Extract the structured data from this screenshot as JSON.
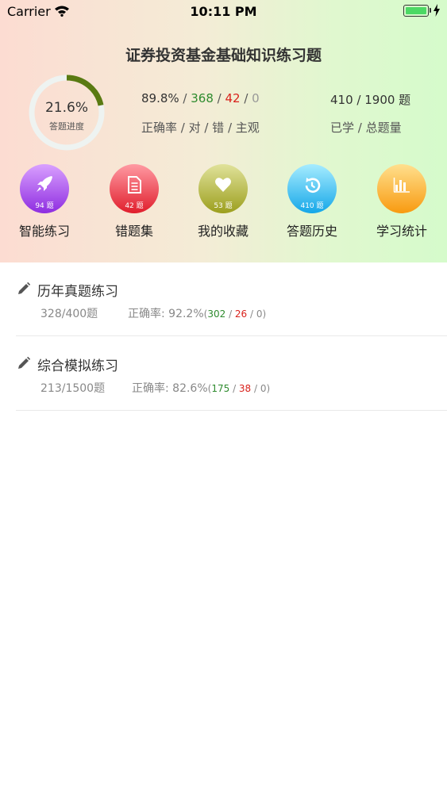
{
  "status_bar": {
    "carrier": "Carrier",
    "time": "10:11 PM",
    "battery_level": 1.0
  },
  "header": {
    "title": "证券投资基金基础知识练习题",
    "progress": {
      "percent_text": "21.6%",
      "label": "答题进度",
      "fraction": 0.216
    },
    "accuracy_stats": {
      "accuracy": "89.8%",
      "correct": "368",
      "wrong": "42",
      "subjective": "0",
      "labels": "正确率 / 对 / 错 / 主观"
    },
    "learned_stats": {
      "learned": "410",
      "total": "1900 题",
      "labels": "已学 / 总题量"
    }
  },
  "shortcuts": [
    {
      "label": "智能练习",
      "count": "94 题",
      "icon": "rocket-icon",
      "colors": [
        "#d9a0ff",
        "#8e2de0"
      ]
    },
    {
      "label": "错题集",
      "count": "42 题",
      "icon": "document-icon",
      "colors": [
        "#ff9aa3",
        "#e01e2c"
      ]
    },
    {
      "label": "我的收藏",
      "count": "53 题",
      "icon": "heart-icon",
      "colors": [
        "#e0e29a",
        "#9c9f1e"
      ]
    },
    {
      "label": "答题历史",
      "count": "410 题",
      "icon": "history-icon",
      "colors": [
        "#a6ecff",
        "#15a7e8"
      ]
    },
    {
      "label": "学习统计",
      "count": "",
      "icon": "bar-chart-icon",
      "colors": [
        "#ffe08e",
        "#f89a10"
      ]
    }
  ],
  "practice_list": [
    {
      "title": "历年真题练习",
      "progress": "328/400题",
      "accuracy_label": "正确率:",
      "accuracy": "92.2%",
      "paren_open": "(",
      "correct": "302",
      "wrong": "26",
      "subjective": "0",
      "paren_close": ")"
    },
    {
      "title": "综合模拟练习",
      "progress": "213/1500题",
      "accuracy_label": "正确率:",
      "accuracy": "82.6%",
      "paren_open": "(",
      "correct": "175",
      "wrong": "38",
      "subjective": "0",
      "paren_close": ")"
    }
  ]
}
